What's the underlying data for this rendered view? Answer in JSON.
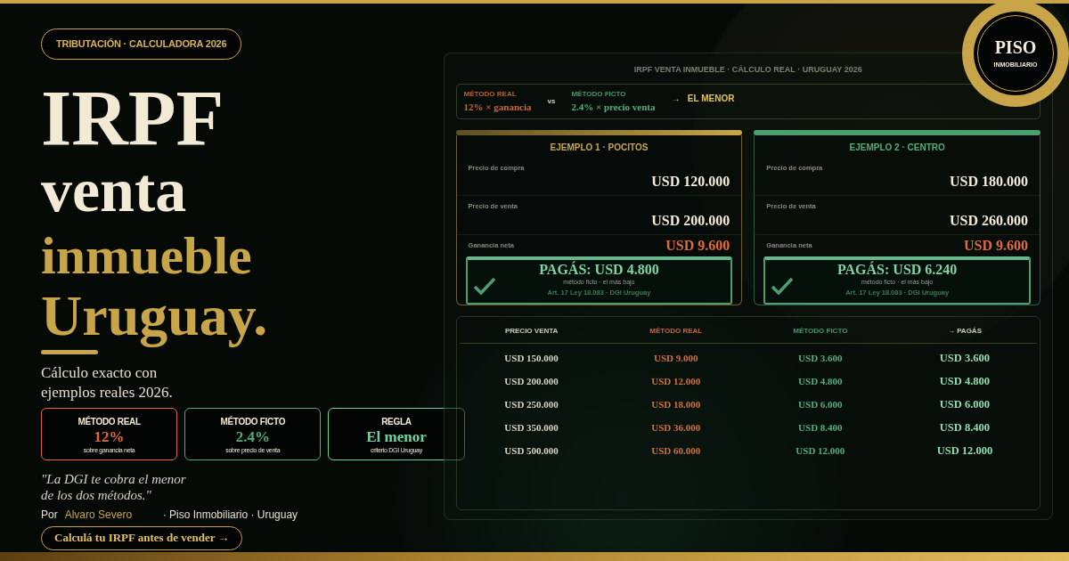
{
  "tag": "TRIBUTACIÓN · CALCULADORA 2026",
  "headline": [
    {
      "text": "IRPF",
      "kind": "light"
    },
    {
      "text": "venta",
      "kind": "light"
    },
    {
      "text": "inmueble",
      "kind": "gold"
    },
    {
      "text": "Uruguay.",
      "kind": "gold"
    }
  ],
  "subtitle": [
    "Cálculo exacto con",
    "ejemplos reales 2026."
  ],
  "stats": [
    {
      "kind": "real",
      "label": "MÉTODO REAL",
      "value": "12%",
      "note": "sobre ganancia neta"
    },
    {
      "kind": "ficto",
      "label": "MÉTODO FICTO",
      "value": "2.4%",
      "note": "sobre precio de venta"
    },
    {
      "kind": "rule",
      "label": "REGLA",
      "value": "El menor",
      "note": "criterio DGI Uruguay"
    }
  ],
  "quote": [
    "\"La DGI te cobra el menor",
    "de los dos métodos.\""
  ],
  "byline": {
    "prefix": "Por",
    "author": "Alvaro Severo",
    "rest": "· Piso Inmobiliario · Uruguay"
  },
  "cta": "Calculá tu IRPF antes de vender →",
  "logo": {
    "name": "PISO",
    "sub": "INMOBILIARIO"
  },
  "panel": {
    "title": "IRPF VENTA INMUEBLE · CÁLCULO REAL · URUGUAY 2026",
    "formula": {
      "real_label": "MÉTODO REAL",
      "real_formula": "12% × ganancia",
      "vs": "vs",
      "ficto_label": "MÉTODO FICTO",
      "ficto_formula": "2.4% × precio venta",
      "result": "→   EL MENOR"
    },
    "examples": [
      {
        "kind": "gold",
        "title": "EJEMPLO 1 · POCITOS",
        "rows": [
          {
            "label": "Precio de compra",
            "value": "USD 120.000"
          },
          {
            "label": "Precio de venta",
            "value": "USD 200.000"
          }
        ],
        "net_label": "Ganancia neta",
        "net_value": "USD 9.600",
        "pay": "PAGÁS: USD 4.800",
        "pay_note": "método ficto · el más bajo",
        "law": "Art. 17 Ley 18.083 · DGI Uruguay"
      },
      {
        "kind": "green",
        "title": "EJEMPLO 2 · CENTRO",
        "rows": [
          {
            "label": "Precio de compra",
            "value": "USD 180.000"
          },
          {
            "label": "Precio de venta",
            "value": "USD 260.000"
          }
        ],
        "net_label": "Ganancia neta",
        "net_value": "USD 9.600",
        "pay": "PAGÁS: USD 6.240",
        "pay_note": "método ficto · el más bajo",
        "law": "Art. 17 Ley 18.083 · DGI Uruguay"
      }
    ],
    "table": {
      "columns": [
        {
          "kind": "price",
          "label": "PRECIO VENTA"
        },
        {
          "kind": "real",
          "label": "MÉTODO REAL"
        },
        {
          "kind": "ficto",
          "label": "MÉTODO FICTO"
        },
        {
          "kind": "pay",
          "label": "→ PAGÁS"
        }
      ],
      "rows": [
        [
          "USD 150.000",
          "USD 9.000",
          "USD 3.600",
          "USD 3.600"
        ],
        [
          "USD 200.000",
          "USD 12.000",
          "USD 4.800",
          "USD 4.800"
        ],
        [
          "USD 250.000",
          "USD 18.000",
          "USD 6.000",
          "USD 6.000"
        ],
        [
          "USD 350.000",
          "USD 36.000",
          "USD 8.400",
          "USD 8.400"
        ],
        [
          "USD 500.000",
          "USD 60.000",
          "USD 12.000",
          "USD 12.000"
        ]
      ]
    }
  }
}
